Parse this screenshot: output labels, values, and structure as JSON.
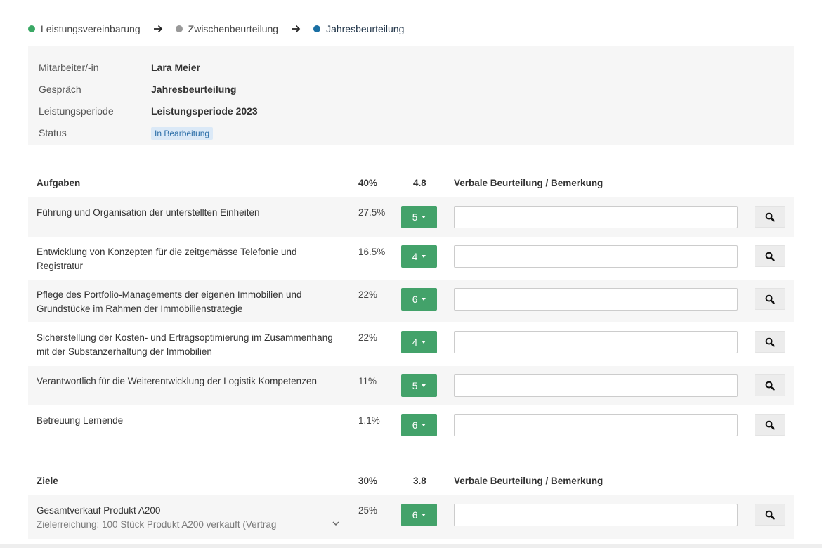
{
  "stepper": {
    "steps": [
      {
        "label": "Leistungsvereinbarung",
        "color": "#3aa865"
      },
      {
        "label": "Zwischenbeurteilung",
        "color": "#999999"
      },
      {
        "label": "Jahresbeurteilung",
        "color": "#1a6fa3"
      }
    ],
    "arrow_icon": "arrow-right-icon"
  },
  "info": {
    "rows": [
      {
        "key": "Mitarbeiter/-in",
        "value": "Lara Meier"
      },
      {
        "key": "Gespräch",
        "value": "Jahresbeurteilung"
      },
      {
        "key": "Leistungsperiode",
        "value": "Leistungsperiode 2023"
      },
      {
        "key": "Status",
        "value": "In Bearbeitung"
      }
    ]
  },
  "aufgaben": {
    "header": {
      "title": "Aufgaben",
      "weight": "40%",
      "average": "4.8",
      "comment": "Verbale Beurteilung / Bemerkung"
    },
    "rows": [
      {
        "title": "Führung und Organisation der unterstellten Einheiten",
        "weight": "27.5%",
        "rating": "5",
        "comment": ""
      },
      {
        "title": "Entwicklung von Konzepten für die zeitgemässe Telefonie und Registratur",
        "weight": "16.5%",
        "rating": "4",
        "comment": ""
      },
      {
        "title": "Pflege des Portfolio-Managements der eigenen Immobilien und Grundstücke im Rahmen der Immobilienstrategie",
        "weight": "22%",
        "rating": "6",
        "comment": ""
      },
      {
        "title": "Sicherstellung der Kosten- und Ertragsoptimierung im Zusammenhang mit der Substanzerhaltung der Immobilien",
        "weight": "22%",
        "rating": "4",
        "comment": ""
      },
      {
        "title": "Verantwortlich für die Weiterentwicklung der Logistik Kompetenzen",
        "weight": "11%",
        "rating": "5",
        "comment": ""
      },
      {
        "title": "Betreuung Lernende",
        "weight": "1.1%",
        "rating": "6",
        "comment": ""
      }
    ]
  },
  "ziele": {
    "header": {
      "title": "Ziele",
      "weight": "30%",
      "average": "3.8",
      "comment": "Verbale Beurteilung / Bemerkung"
    },
    "rows": [
      {
        "title": "Gesamtverkauf Produkt A200",
        "subtitle": "Zielerreichung: 100 Stück Produkt A200 verkauft (Vertrag",
        "weight": "25%",
        "rating": "6",
        "comment": ""
      }
    ]
  },
  "colors": {
    "rating_button": "#43a26a",
    "badge_bg": "#dbe9f7",
    "badge_text": "#2d6fa8",
    "panel_bg": "#f6f6f6"
  },
  "icons": {
    "search": "search-icon",
    "dropdown": "caret-down-icon",
    "expand": "chevron-down-icon"
  }
}
